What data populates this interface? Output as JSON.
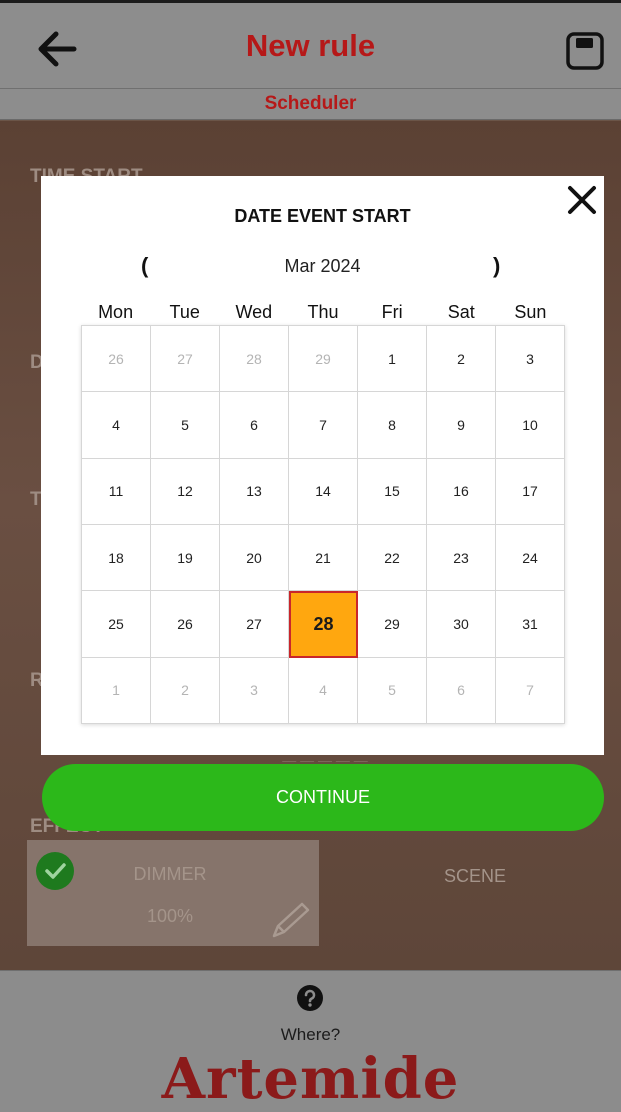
{
  "header": {
    "title": "New rule",
    "subtitle": "Scheduler",
    "back_icon": "arrow-left-icon",
    "save_icon": "floppy-disk-icon"
  },
  "background": {
    "labels": [
      {
        "name": "time-start-label",
        "text": "TIME START"
      },
      {
        "name": "date-label",
        "text": "D"
      },
      {
        "name": "time-label",
        "text": "T"
      },
      {
        "name": "repeat-label",
        "text": "R"
      },
      {
        "name": "effect-label",
        "text": "EFFECT"
      }
    ],
    "dimmer_card": {
      "title": "DIMMER",
      "value": "100%"
    },
    "scene_label": "SCENE"
  },
  "modal": {
    "title": "DATE EVENT START",
    "month_label": "Mar 2024",
    "prev_symbol": "(",
    "next_symbol": ")",
    "weekdays": [
      "Mon",
      "Tue",
      "Wed",
      "Thu",
      "Fri",
      "Sat",
      "Sun"
    ],
    "selected_day": "28",
    "weeks": [
      [
        {
          "d": "26",
          "m": true
        },
        {
          "d": "27",
          "m": true
        },
        {
          "d": "28",
          "m": true
        },
        {
          "d": "29",
          "m": true
        },
        {
          "d": "1"
        },
        {
          "d": "2"
        },
        {
          "d": "3"
        }
      ],
      [
        {
          "d": "4"
        },
        {
          "d": "5"
        },
        {
          "d": "6"
        },
        {
          "d": "7"
        },
        {
          "d": "8"
        },
        {
          "d": "9"
        },
        {
          "d": "10"
        }
      ],
      [
        {
          "d": "11"
        },
        {
          "d": "12"
        },
        {
          "d": "13"
        },
        {
          "d": "14"
        },
        {
          "d": "15"
        },
        {
          "d": "16"
        },
        {
          "d": "17"
        }
      ],
      [
        {
          "d": "18"
        },
        {
          "d": "19"
        },
        {
          "d": "20"
        },
        {
          "d": "21"
        },
        {
          "d": "22"
        },
        {
          "d": "23"
        },
        {
          "d": "24"
        }
      ],
      [
        {
          "d": "25"
        },
        {
          "d": "26"
        },
        {
          "d": "27"
        },
        {
          "d": "28",
          "s": true
        },
        {
          "d": "29"
        },
        {
          "d": "30"
        },
        {
          "d": "31"
        }
      ],
      [
        {
          "d": "1",
          "m": true
        },
        {
          "d": "2",
          "m": true
        },
        {
          "d": "3",
          "m": true
        },
        {
          "d": "4",
          "m": true
        },
        {
          "d": "5",
          "m": true
        },
        {
          "d": "6",
          "m": true
        },
        {
          "d": "7",
          "m": true
        }
      ]
    ]
  },
  "continue_label": "CONTINUE",
  "footer": {
    "help_icon": "question-circle-icon",
    "where_label": "Where?",
    "brand": "Artemide"
  },
  "colors": {
    "accent_red": "#b61818",
    "selected_day_bg": "#ffa70f",
    "selected_day_border": "#c9262b",
    "continue_green": "#2cb81a",
    "brand_red": "#8b1a1a"
  }
}
